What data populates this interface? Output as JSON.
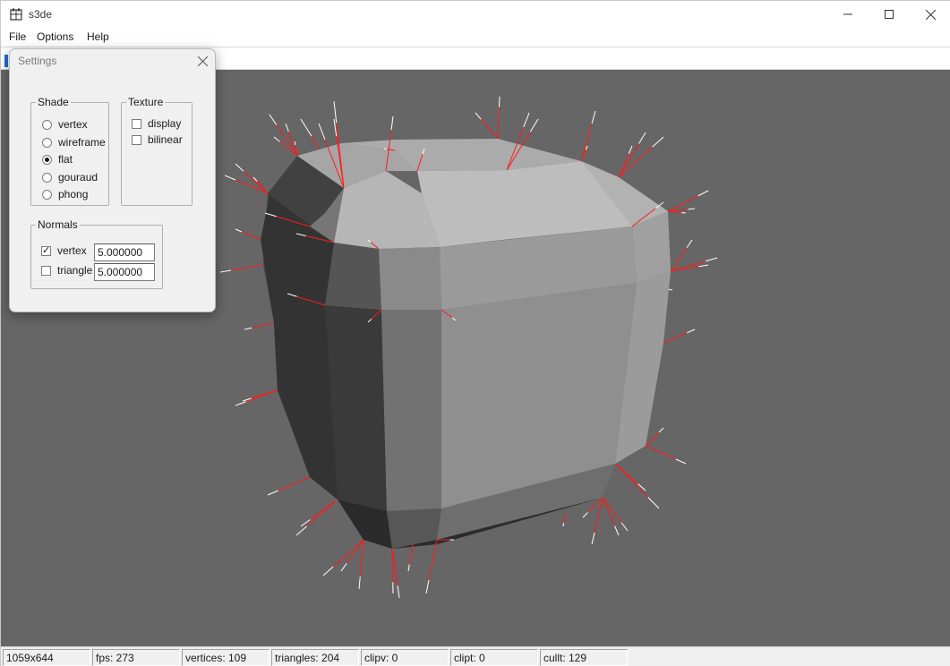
{
  "window": {
    "title": "s3de"
  },
  "menu": {
    "items": [
      "File",
      "Options",
      "Help"
    ]
  },
  "settings": {
    "title": "Settings",
    "shade": {
      "legend": "Shade",
      "options": [
        "vertex",
        "wireframe",
        "flat",
        "gouraud",
        "phong"
      ],
      "selected": "flat"
    },
    "texture": {
      "legend": "Texture",
      "display_label": "display",
      "display_checked": false,
      "bilinear_label": "bilinear",
      "bilinear_checked": false
    },
    "normals": {
      "legend": "Normals",
      "vertex_label": "vertex",
      "vertex_checked": true,
      "vertex_value": "5.000000",
      "triangle_label": "triangle",
      "triangle_checked": false,
      "triangle_value": "5.000000"
    }
  },
  "status": {
    "resolution": "1059x644",
    "fps": "fps: 273",
    "vertices": "vertices: 109",
    "triangles": "triangles: 204",
    "clipv": "clipv: 0",
    "clipt": "clipt: 0",
    "cullt": "cullt: 129"
  },
  "colors": {
    "viewport_bg": "#666666",
    "normal_line": "#ff1a1a",
    "normal_tip": "#ffffff",
    "accent": "#1e6fd0"
  }
}
